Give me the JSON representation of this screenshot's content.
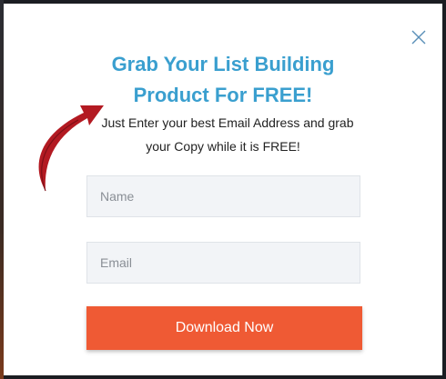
{
  "popup": {
    "headline_line1": "Grab Your List Building",
    "headline_line2": "Product For FREE!",
    "subtext_line1": "Just Enter your best Email Address and grab",
    "subtext_line2": "your Copy while it is FREE!",
    "name_placeholder": "Name",
    "email_placeholder": "Email",
    "button_label": "Download Now",
    "close_icon": "close-icon",
    "arrow_icon": "curved-arrow-icon"
  },
  "colors": {
    "headline": "#3a9fcf",
    "button": "#ef5a34",
    "arrow": "#b31a22",
    "field_bg": "#f2f4f7",
    "close_icon": "#5a8fb8"
  }
}
